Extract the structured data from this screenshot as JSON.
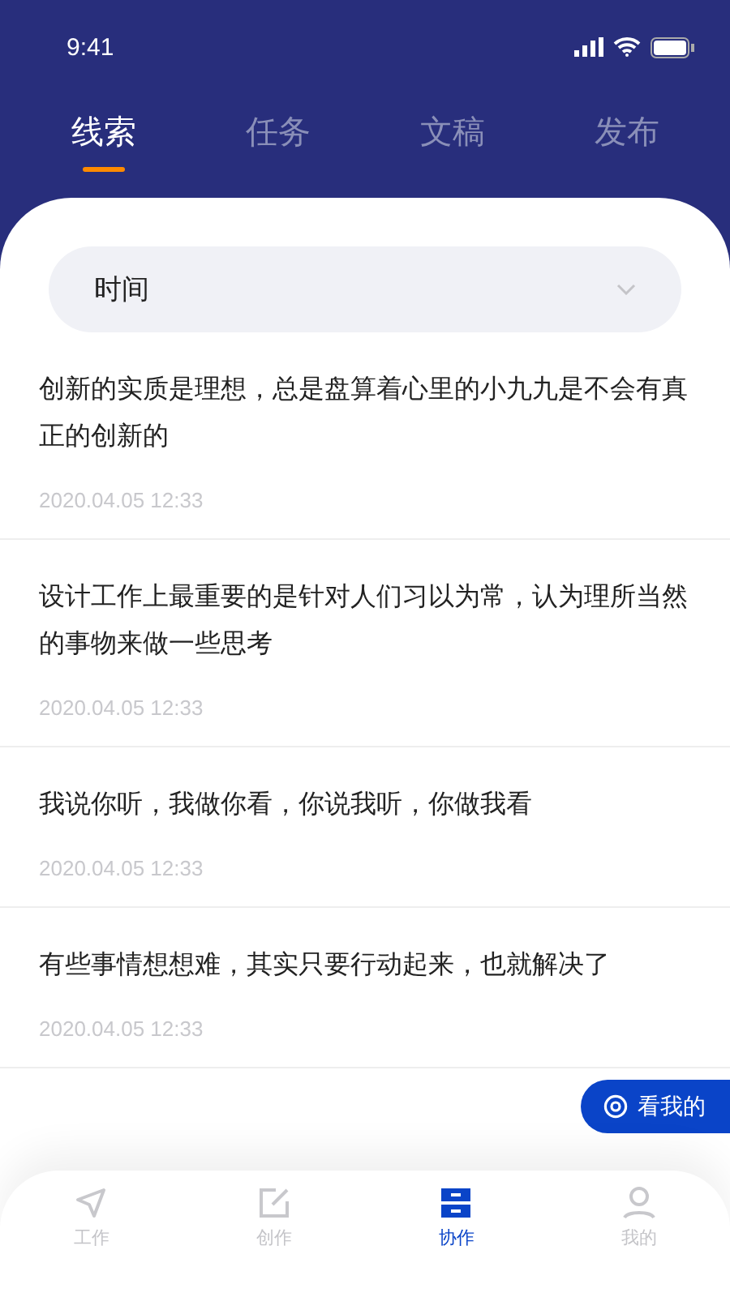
{
  "status_bar": {
    "time": "9:41"
  },
  "tabs": [
    {
      "label": "线索",
      "selected": true
    },
    {
      "label": "任务",
      "selected": false
    },
    {
      "label": "文稿",
      "selected": false
    },
    {
      "label": "发布",
      "selected": false
    }
  ],
  "filter": {
    "value": "时间"
  },
  "items": [
    {
      "text": "创新的实质是理想，总是盘算着心里的小九九是不会有真正的创新的",
      "time": "2020.04.05 12:33"
    },
    {
      "text": "设计工作上最重要的是针对人们习以为常，认为理所当然的事物来做一些思考",
      "time": "2020.04.05 12:33"
    },
    {
      "text": "我说你听，我做你看，你说我听，你做我看",
      "time": "2020.04.05 12:33"
    },
    {
      "text": "有些事情想想难，其实只要行动起来，也就解决了",
      "time": "2020.04.05 12:33"
    }
  ],
  "float_button": {
    "label": "看我的"
  },
  "nav": [
    {
      "label": "工作",
      "kind": "send",
      "selected": false
    },
    {
      "label": "创作",
      "kind": "edit",
      "selected": false
    },
    {
      "label": "协作",
      "kind": "drawer",
      "selected": true
    },
    {
      "label": "我的",
      "kind": "user",
      "selected": false
    }
  ]
}
